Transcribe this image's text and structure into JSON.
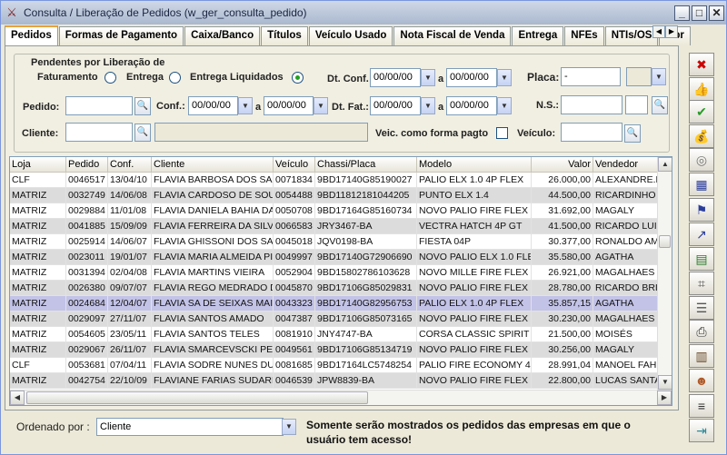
{
  "window": {
    "title": "Consulta / Liberação de Pedidos (w_ger_consulta_pedido)"
  },
  "tabs": [
    "Pedidos",
    "Formas de Pagamento",
    "Caixa/Banco",
    "Títulos",
    "Veículo Usado",
    "Nota Fiscal de Venda",
    "Entrega",
    "NFEs",
    "NTIs/OS",
    "Obr"
  ],
  "filters": {
    "pending_title": "Pendentes por Liberação de",
    "opt_faturamento": "Faturamento",
    "opt_entrega": "Entrega",
    "opt_entrega_liq": "Entrega Liquidados",
    "selected_option": "Entrega Liquidados",
    "dt_conf_label": "Dt. Conf.",
    "dt_conf_from": "00/00/00",
    "dt_conf_to": "00/00/00",
    "a": "a",
    "placa_label": "Placa:",
    "placa_value": "-",
    "pedido_label": "Pedido:",
    "conf_label": "Conf.:",
    "conf_from": "00/00/00",
    "conf_to": "00/00/00",
    "dt_fat_label": "Dt. Fat.:",
    "dt_fat_from": "00/00/00",
    "dt_fat_to": "00/00/00",
    "ns_label": "N.S.:",
    "cliente_label": "Cliente:",
    "veic_pagto_label": "Veic. como forma pagto",
    "veiculo_label": "Veículo:"
  },
  "grid": {
    "columns": [
      "Loja",
      "Pedido",
      "Conf.",
      "Cliente",
      "Veículo",
      "Chassi/Placa",
      "Modelo",
      "Valor",
      "Vendedor"
    ],
    "rows": [
      [
        "CLF",
        "0046517",
        "13/04/10",
        "FLAVIA BARBOSA DOS SA",
        "0071834",
        "9BD17140G85190027",
        "PALIO ELX 1.0 4P FLEX",
        "26.000,00",
        "ALEXANDRE.R"
      ],
      [
        "MATRIZ",
        "0032749",
        "14/06/08",
        "FLAVIA CARDOSO DE SOU",
        "0054488",
        "9BD11812181044205",
        "PUNTO ELX 1.4",
        "44.500,00",
        "RICARDINHO"
      ],
      [
        "MATRIZ",
        "0029884",
        "11/01/08",
        "FLAVIA DANIELA BAHIA DA",
        "0050708",
        "9BD17164G85160734",
        "NOVO PALIO FIRE FLEX 4",
        "31.692,00",
        "MAGALY"
      ],
      [
        "MATRIZ",
        "0041885",
        "15/09/09",
        "FLAVIA FERREIRA DA SILV",
        "0066583",
        "JRY3467-BA",
        "VECTRA HATCH 4P GT",
        "41.500,00",
        "RICARDO LUIS"
      ],
      [
        "MATRIZ",
        "0025914",
        "14/06/07",
        "FLAVIA GHISSONI DOS SA",
        "0045018",
        "JQV0198-BA",
        "FIESTA 04P",
        "30.377,00",
        "RONALDO AMO"
      ],
      [
        "MATRIZ",
        "0023011",
        "19/01/07",
        "FLAVIA MARIA ALMEIDA PI",
        "0049997",
        "9BD17140G72906690",
        "NOVO PALIO ELX 1.0 FLE",
        "35.580,00",
        "AGATHA"
      ],
      [
        "MATRIZ",
        "0031394",
        "02/04/08",
        "FLAVIA MARTINS VIEIRA",
        "0052904",
        "9BD15802786103628",
        "NOVO MILLE FIRE FLEX 2",
        "26.921,00",
        "MAGALHAES"
      ],
      [
        "MATRIZ",
        "0026380",
        "09/07/07",
        "FLAVIA REGO MEDRADO D",
        "0045870",
        "9BD17106G85029831",
        "NOVO PALIO FIRE FLEX 2",
        "28.780,00",
        "RICARDO BRIT"
      ],
      [
        "MATRIZ",
        "0024684",
        "12/04/07",
        "FLAVIA SA DE SEIXAS MAI",
        "0043323",
        "9BD17140G82956753",
        "PALIO ELX 1.0 4P FLEX",
        "35.857,15",
        "AGATHA"
      ],
      [
        "MATRIZ",
        "0029097",
        "27/11/07",
        "FLAVIA SANTOS AMADO",
        "0047387",
        "9BD17106G85073165",
        "NOVO PALIO FIRE FLEX 2",
        "30.230,00",
        "MAGALHAES"
      ],
      [
        "MATRIZ",
        "0054605",
        "23/05/11",
        "FLAVIA SANTOS TELES",
        "0081910",
        "JNY4747-BA",
        "CORSA CLASSIC SPIRIT F",
        "21.500,00",
        "MOISÉS"
      ],
      [
        "MATRIZ",
        "0029067",
        "26/11/07",
        "FLAVIA SMARCEVSCKI PEI",
        "0049561",
        "9BD17106G85134719",
        "NOVO PALIO FIRE FLEX 2",
        "30.256,00",
        "MAGALY"
      ],
      [
        "CLF",
        "0053681",
        "07/04/11",
        "FLAVIA SODRE NUNES DU",
        "0081685",
        "9BD17164LC5748254",
        "PALIO FIRE ECONOMY 4P",
        "28.991,04",
        "MANOEL FAHE"
      ],
      [
        "MATRIZ",
        "0042754",
        "22/10/09",
        "FLAVIANE FARIAS SUDARI",
        "0046539",
        "JPW8839-BA",
        "NOVO PALIO FIRE FLEX 4",
        "22.800,00",
        "LUCAS SANTA"
      ]
    ],
    "selected_row": 8
  },
  "footer": {
    "order_label": "Ordenado por :",
    "order_value": "Cliente",
    "message": "Somente serão mostrados os pedidos das empresas em que o usuário tem acesso!"
  },
  "toolbar_icons": [
    "close-icon",
    "thumbs-up-icon",
    "check-icon",
    "money-bag-icon",
    "coins-icon",
    "grid-icon",
    "run-icon",
    "chart-icon",
    "table-icon",
    "calculator-icon",
    "document-search-icon",
    "printer-icon",
    "book-icon",
    "people-icon",
    "list-icon",
    "exit-icon"
  ]
}
